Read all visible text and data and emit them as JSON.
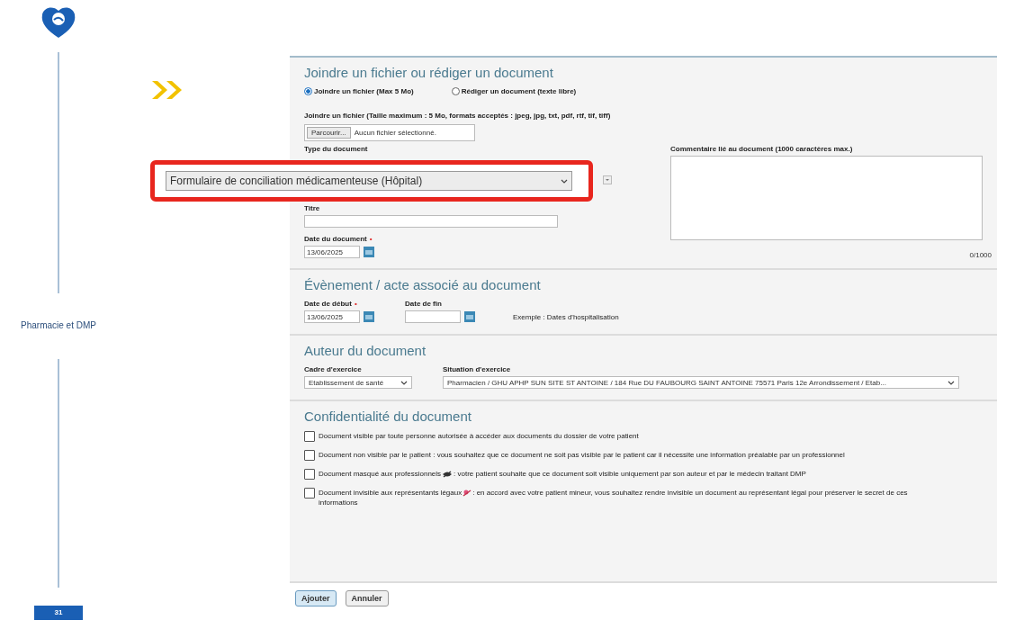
{
  "slide": {
    "section_label": "Pharmacie et DMP",
    "page_number": "31"
  },
  "attach_section": {
    "title": "Joindre un fichier ou rédiger un document",
    "radios": [
      {
        "label": "Joindre un fichier (Max 5 Mo)",
        "selected": true
      },
      {
        "label": "Rédiger un document (texte libre)",
        "selected": false
      }
    ],
    "file_label": "Joindre un fichier (Taille maximum : 5 Mo, formats acceptés : jpeg, jpg, txt, pdf, rtf, tif, tiff)",
    "browse_button": "Parcourir...",
    "file_status": "Aucun fichier sélectionné.",
    "type_label": "Type du document",
    "type_value": "Formulaire de conciliation médicamenteuse (Hôpital)",
    "title_label": "Titre",
    "date_label": "Date du document",
    "date_required_mark": "•",
    "date_value": "13/06/2025",
    "comment_label": "Commentaire lié au document (1000 caractères max.)",
    "comment_count": "0/1000"
  },
  "event_section": {
    "title": "Évènement / acte associé au document",
    "start_label": "Date de début",
    "start_required_mark": "•",
    "start_value": "13/06/2025",
    "end_label": "Date de fin",
    "example": "Exemple : Dates d'hospitalisation"
  },
  "author_section": {
    "title": "Auteur du document",
    "cadre_label": "Cadre d'exercice",
    "cadre_value": "Etablissement de santé",
    "situation_label": "Situation d'exercice",
    "situation_value": "Pharmacien / GHU APHP SUN SITE ST ANTOINE / 184 Rue DU FAUBOURG SAINT ANTOINE 75571 Paris 12e Arrondissement / Etab..."
  },
  "confidentiality_section": {
    "title": "Confidentialité du document",
    "options": [
      {
        "kind": "plain",
        "checked": false,
        "text": "Document visible par toute personne autorisée à accéder aux documents du dossier de votre patient"
      },
      {
        "kind": "plain",
        "checked": false,
        "text": "Document non visible par le patient : vous souhaitez que ce document ne soit pas visible par le patient car il nécessite une information préalable par un professionnel"
      },
      {
        "kind": "masked",
        "checked": false,
        "text": "Document masqué aux professionnels",
        "text_after": ": votre patient souhaite que ce document soit visible uniquement par son auteur et par le médecin traitant DMP"
      },
      {
        "kind": "legal",
        "checked": false,
        "text": "Document invisible aux représentants légaux",
        "text_after": ": en accord avec votre patient mineur, vous souhaitez rendre invisible un document au représentant légal pour préserver le secret de ces informations"
      }
    ]
  },
  "buttons": [
    {
      "label": "Ajouter",
      "kind": "primary"
    },
    {
      "label": "Annuler",
      "kind": "secondary"
    }
  ]
}
